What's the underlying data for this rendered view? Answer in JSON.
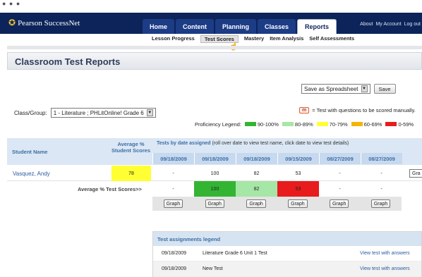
{
  "app": {
    "logo": "Pearson SuccessNet",
    "tabs": [
      {
        "label": "Home",
        "active": false
      },
      {
        "label": "Content",
        "active": false
      },
      {
        "label": "Planning",
        "active": false
      },
      {
        "label": "Classes",
        "active": false
      },
      {
        "label": "Reports",
        "active": true
      }
    ],
    "account_links": [
      "About",
      "My Account",
      "Log out"
    ],
    "subnav": [
      {
        "label": "Lesson Progress",
        "active": false
      },
      {
        "label": "Test Scores",
        "active": true
      },
      {
        "label": "Mastery",
        "active": false
      },
      {
        "label": "Item Analysis",
        "active": false
      },
      {
        "label": "Self Assessments",
        "active": false
      }
    ]
  },
  "page": {
    "title": "Classroom Test Reports",
    "export_select": "Save as Spreadsheet",
    "save_button": "Save",
    "class_group_label": "Class/Group:",
    "class_group_value": "1 - Literature ; PHLitOnline! Grade 6",
    "manual_badge": "m",
    "manual_note": "= Test with questions to be scored manually.",
    "legend": {
      "title": "Proficiency Legend:",
      "items": [
        {
          "label": "90-100%",
          "color": "#33b533"
        },
        {
          "label": "80-89%",
          "color": "#a6e6a6"
        },
        {
          "label": "70-79%",
          "color": "#ffff33"
        },
        {
          "label": "60-69%",
          "color": "#f4b400"
        },
        {
          "label": "0-59%",
          "color": "#e81c1c"
        }
      ]
    }
  },
  "table": {
    "student_name_header": "Student Name",
    "avg_header": "Average % Student Scores",
    "tests_header": "Tests by date assigned",
    "tests_note": "(roll over date to view test name, click date to view test details)",
    "dates": [
      "09/18/2009",
      "09/18/2009",
      "09/18/2009",
      "09/15/2009",
      "08/27/2009",
      "08/27/2009"
    ],
    "student": {
      "name": "Vasquez, Andy",
      "average": "78",
      "scores": [
        "-",
        "100",
        "82",
        "53",
        "-",
        "-"
      ],
      "graph_label": "Gra"
    },
    "average_row": {
      "label": "Average % Test Scores>>",
      "values": [
        "-",
        "100",
        "82",
        "53",
        "-",
        "-"
      ],
      "colors": [
        "",
        "#33b533",
        "#a6e6a6",
        "#e81c1c",
        "",
        ""
      ]
    },
    "graph_label": "Graph"
  },
  "assignments_legend": {
    "title": "Test assignments legend",
    "rows": [
      {
        "date": "09/18/2009",
        "name": "Literature Grade 6 Unit 1 Test",
        "link": "View test with answers"
      },
      {
        "date": "09/18/2009",
        "name": "New Test",
        "link": "View test with answers"
      }
    ]
  }
}
